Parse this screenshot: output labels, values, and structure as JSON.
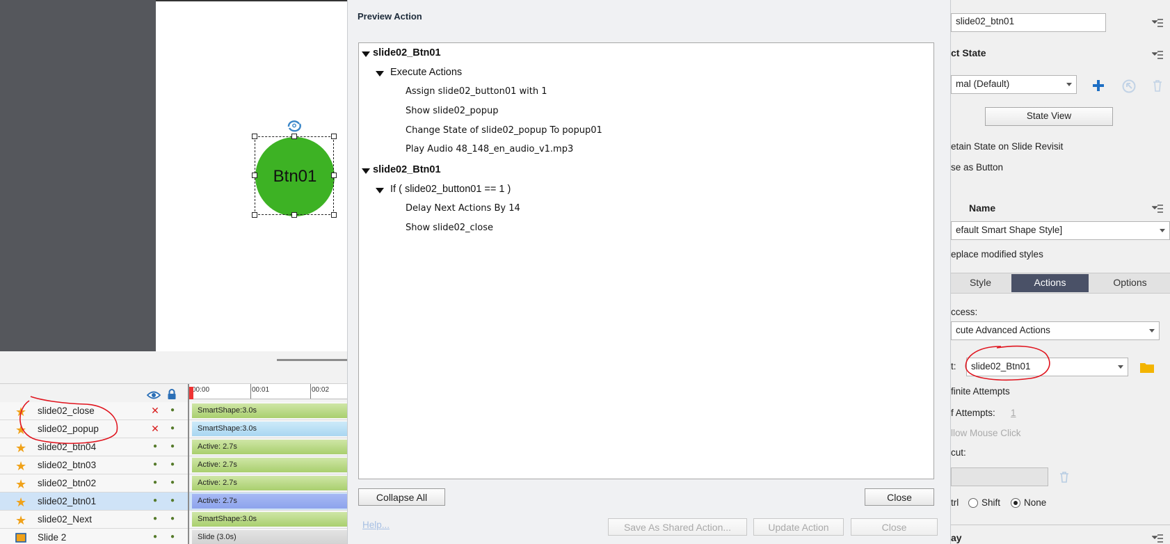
{
  "stage": {
    "button_label": "Btn01"
  },
  "timeline": {
    "ticks": [
      "00:00",
      "00:01",
      "00:02"
    ],
    "rows": [
      {
        "name": "slide02_close",
        "eye": "x",
        "bar": "SmartShape:3.0s",
        "bar_style": "green",
        "selected": false
      },
      {
        "name": "slide02_popup",
        "eye": "x",
        "bar": "SmartShape:3.0s",
        "bar_style": "blue-light",
        "selected": false
      },
      {
        "name": "slide02_btn04",
        "eye": "dot",
        "bar": "Active: 2.7s",
        "bar_style": "green",
        "selected": false
      },
      {
        "name": "slide02_btn03",
        "eye": "dot",
        "bar": "Active: 2.7s",
        "bar_style": "green",
        "selected": false
      },
      {
        "name": "slide02_btn02",
        "eye": "dot",
        "bar": "Active: 2.7s",
        "bar_style": "green",
        "selected": false
      },
      {
        "name": "slide02_btn01",
        "eye": "dot",
        "bar": "Active: 2.7s",
        "bar_style": "blue",
        "selected": true
      },
      {
        "name": "slide02_Next",
        "eye": "dot",
        "bar": "SmartShape:3.0s",
        "bar_style": "green",
        "selected": false
      },
      {
        "name": "Slide 2",
        "eye": "dot",
        "bar": "Slide (3.0s)",
        "bar_style": "gray",
        "selected": false,
        "is_slide": true
      }
    ]
  },
  "dialog": {
    "title": "Preview Action",
    "tree": [
      {
        "text": "slide02_Btn01",
        "level": 0,
        "expanded": true
      },
      {
        "text": "Execute Actions",
        "level": 1,
        "expanded": true
      },
      {
        "text": "Assign slide02_button01 with 1",
        "level": 2
      },
      {
        "text": "Show slide02_popup",
        "level": 2
      },
      {
        "text": "Change State of slide02_popup To popup01",
        "level": 2
      },
      {
        "text": "Play Audio 48_148_en_audio_v1.mp3",
        "level": 2
      },
      {
        "text": "slide02_Btn01",
        "level": 0,
        "expanded": true
      },
      {
        "text": "If ( slide02_button01 == 1  )",
        "level": 1,
        "expanded": true
      },
      {
        "text": "Delay Next Actions By 14",
        "level": 2
      },
      {
        "text": "Show slide02_close",
        "level": 2
      }
    ],
    "collapse_all": "Collapse All",
    "close": "Close",
    "help": "Help...",
    "save_shared": "Save As Shared Action...",
    "update_action": "Update Action",
    "close_bottom": "Close"
  },
  "properties": {
    "name_value": "slide02_btn01",
    "object_state_heading": "ct State",
    "state_select": "mal (Default)",
    "state_view": "State View",
    "retain_state": "etain State on Slide Revisit",
    "use_as_button": "se as Button",
    "style_name_heading": "Name",
    "style_select": "efault Smart Shape Style]",
    "replace_styles": "eplace modified styles",
    "tabs": [
      "Style",
      "Actions",
      "Options"
    ],
    "active_tab": "Actions",
    "on_success_label": "ccess:",
    "on_success_select": "cute Advanced Actions",
    "script_label": "t:",
    "script_select": "slide02_Btn01",
    "infinite_attempts": "finite Attempts",
    "attempts_label": "f Attempts:",
    "attempts_value": "1",
    "allow_mouse_click": "llow Mouse Click",
    "shortcut_label": "cut:",
    "modifier_ctrl": "trl",
    "modifier_shift": "Shift",
    "modifier_none": "None",
    "modifier_selected": "None",
    "bottom_heading": "ay"
  },
  "colors": {
    "accent_tab": "#4a5167",
    "button_fill": "#3db224",
    "annotation": "#e0141e",
    "delete_x": "#d81b1b"
  }
}
